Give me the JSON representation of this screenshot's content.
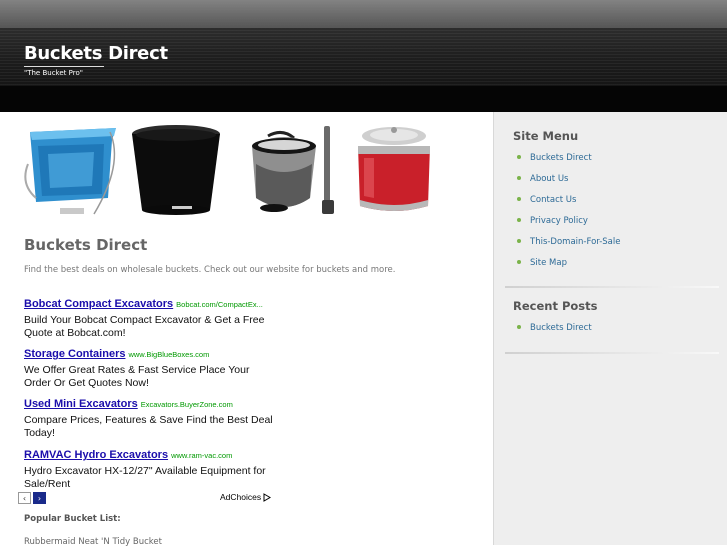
{
  "header": {
    "title": "Buckets Direct",
    "tagline": "\"The Bucket Pro\""
  },
  "main": {
    "heading": "Buckets Direct",
    "intro": "Find the best deals on wholesale buckets. Check out our website for buckets and more.",
    "ads": [
      {
        "title": "Bobcat Compact Excavators",
        "url": "Bobcat.com/CompactEx...",
        "desc": "Build Your Bobcat Compact Excavator & Get a Free Quote at Bobcat.com!"
      },
      {
        "title": "Storage Containers",
        "url": "www.BigBlueBoxes.com",
        "desc": "We Offer Great Rates & Fast Service Place Your Order Or Get Quotes Now!"
      },
      {
        "title": "Used Mini Excavators",
        "url": "Excavators.BuyerZone.com",
        "desc": "Compare Prices, Features & Save Find the Best Deal Today!"
      },
      {
        "title": "RAMVAC Hydro Excavators",
        "url": "www.ram-vac.com",
        "desc": "Hydro Excavator HX-12/27\" Available Equipment for Sale/Rent"
      }
    ],
    "ad_nav": {
      "prev": "‹",
      "next": "›"
    },
    "adchoices": "AdChoices",
    "popular_heading": "Popular Bucket List:",
    "popular_items": [
      "Rubbermaid Neat 'N Tidy Bucket"
    ]
  },
  "sidebar": {
    "site_menu_heading": "Site Menu",
    "site_menu": [
      "Buckets Direct",
      "About Us",
      "Contact Us",
      "Privacy Policy",
      "This-Domain-For-Sale",
      "Site Map"
    ],
    "recent_posts_heading": "Recent Posts",
    "recent_posts": [
      "Buckets Direct"
    ]
  },
  "colors": {
    "link": "#2d6a96",
    "bullet": "#7bb34a",
    "ad_title": "#1a0dab",
    "ad_url": "#009900"
  }
}
